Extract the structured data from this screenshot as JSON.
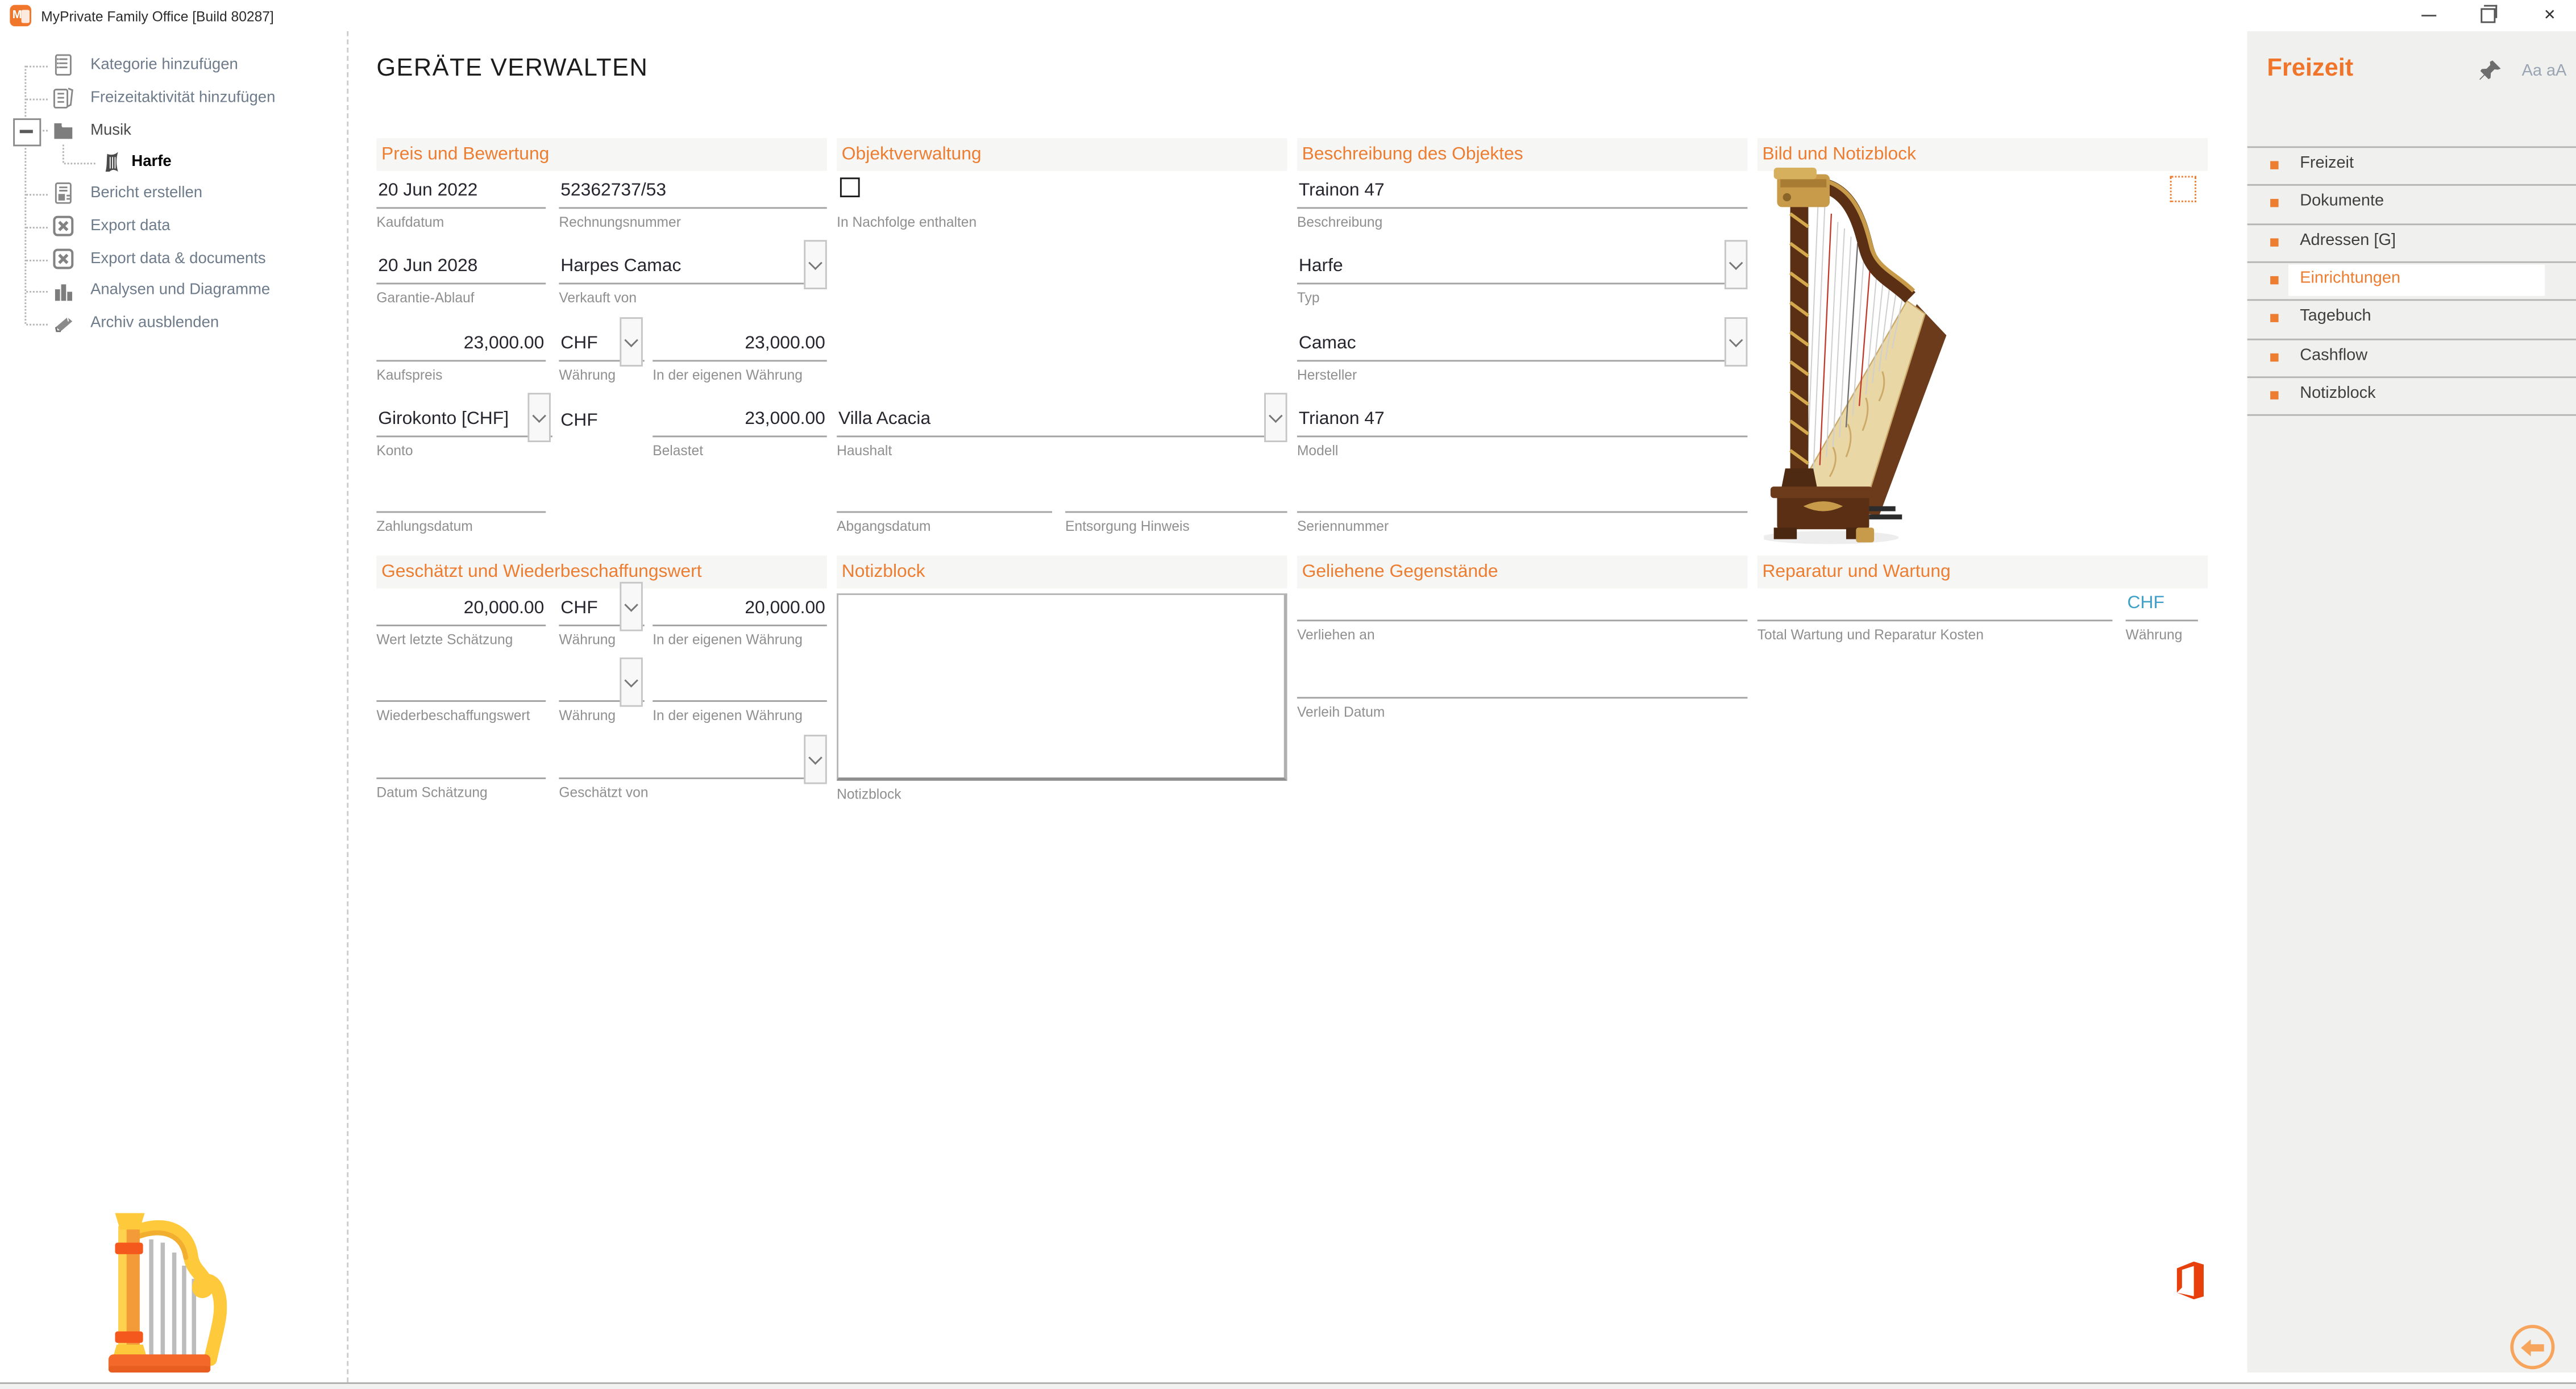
{
  "window": {
    "title": "MyPrivate Family Office [Build 80287]"
  },
  "tree": {
    "items": [
      {
        "label": "Kategorie hinzufügen",
        "icon": "add-category-icon"
      },
      {
        "label": "Freizeitaktivität hinzufügen",
        "icon": "add-leisure-activity-icon"
      },
      {
        "label": "Musik",
        "icon": "folder-icon"
      },
      {
        "label": "Harfe",
        "icon": "harp-icon",
        "selected": true
      },
      {
        "label": "Bericht erstellen",
        "icon": "report-icon"
      },
      {
        "label": "Export data",
        "icon": "excel-export-icon"
      },
      {
        "label": "Export data & documents",
        "icon": "excel-export-icon"
      },
      {
        "label": "Analysen und Diagramme",
        "icon": "bar-chart-icon"
      },
      {
        "label": "Archiv ausblenden",
        "icon": "archive-icon"
      }
    ]
  },
  "main": {
    "title": "GERÄTE VERWALTEN",
    "price": {
      "title": "Preis und Bewertung",
      "kaufdatum": {
        "value": "20 Jun 2022",
        "label": "Kaufdatum"
      },
      "rechnungsnummer": {
        "value": "52362737/53",
        "label": "Rechnungsnummer"
      },
      "garantie_ablauf": {
        "value": "20 Jun 2028",
        "label": "Garantie-Ablauf"
      },
      "verkauft_von": {
        "value": "Harpes Camac",
        "label": "Verkauft von"
      },
      "kaufspreis": {
        "value": "23,000.00",
        "label": "Kaufspreis"
      },
      "waehrung": {
        "value": "CHF",
        "label": "Währung"
      },
      "eigene_waehrung": {
        "value": "23,000.00",
        "label": "In der eigenen Währung"
      },
      "konto": {
        "value": "Girokonto [CHF]",
        "label": "Konto"
      },
      "belastet_waehrung": "CHF",
      "belastet": {
        "value": "23,000.00",
        "label": "Belastet"
      },
      "zahlungsdatum": {
        "value": "",
        "label": "Zahlungsdatum"
      }
    },
    "objekt": {
      "title": "Objektverwaltung",
      "nachfolge": {
        "checked": false,
        "label": "In Nachfolge enthalten"
      },
      "haushalt": {
        "value": "Villa Acacia",
        "label": "Haushalt"
      },
      "abgangsdatum": {
        "value": "",
        "label": "Abgangsdatum"
      },
      "entsorgung": {
        "value": "",
        "label": "Entsorgung Hinweis"
      }
    },
    "beschreibung": {
      "title": "Beschreibung des Objektes",
      "beschreibung": {
        "value": "Trainon 47",
        "label": "Beschreibung"
      },
      "typ": {
        "value": "Harfe",
        "label": "Typ"
      },
      "hersteller": {
        "value": "Camac",
        "label": "Hersteller"
      },
      "modell": {
        "value": "Trianon 47",
        "label": "Modell"
      },
      "seriennummer": {
        "value": "",
        "label": "Seriennummer"
      }
    },
    "bild": {
      "title": "Bild und Notizblock",
      "image": "harp-photo"
    },
    "schaetzung": {
      "title": "Geschätzt und Wiederbeschaffungswert",
      "wert_letzte": {
        "value": "20,000.00",
        "label": "Wert letzte Schätzung"
      },
      "waehrung1": {
        "value": "CHF",
        "label": "Währung"
      },
      "eigene1": {
        "value": "20,000.00",
        "label": "In der eigenen Währung"
      },
      "wiederbeschaffungswert": {
        "value": "",
        "label": "Wiederbeschaffungswert"
      },
      "waehrung2": {
        "value": "",
        "label": "Währung"
      },
      "eigene2": {
        "value": "",
        "label": "In der eigenen Währung"
      },
      "datum_schaetzung": {
        "value": "",
        "label": "Datum Schätzung"
      },
      "geschaetzt_von": {
        "value": "",
        "label": "Geschätzt von"
      }
    },
    "notizblock": {
      "title": "Notizblock",
      "value": "",
      "label": "Notizblock"
    },
    "geliehen": {
      "title": "Geliehene Gegenstände",
      "verliehen_an": {
        "value": "",
        "label": "Verliehen an"
      },
      "verleih_datum": {
        "value": "",
        "label": "Verleih Datum"
      }
    },
    "reparatur": {
      "title": "Reparatur und Wartung",
      "total": {
        "value": "",
        "label": "Total Wartung und Reparatur Kosten"
      },
      "waehrung": {
        "value": "CHF",
        "label": "Währung"
      }
    }
  },
  "panel": {
    "title": "Freizeit",
    "pin_icon": "pushpin-icon",
    "font_size_toggle": "Aa aA",
    "items": [
      {
        "label": "Freizeit"
      },
      {
        "label": "Dokumente"
      },
      {
        "label": "Adressen [G]"
      },
      {
        "label": "Einrichtungen",
        "active": true
      },
      {
        "label": "Tagebuch"
      },
      {
        "label": "Cashflow"
      },
      {
        "label": "Notizblock"
      }
    ],
    "back_icon": "back-arrow-icon"
  },
  "colors": {
    "accent": "#ED7D31",
    "panel_title": "#F0752B",
    "currency_teal": "#3FA0C8"
  }
}
